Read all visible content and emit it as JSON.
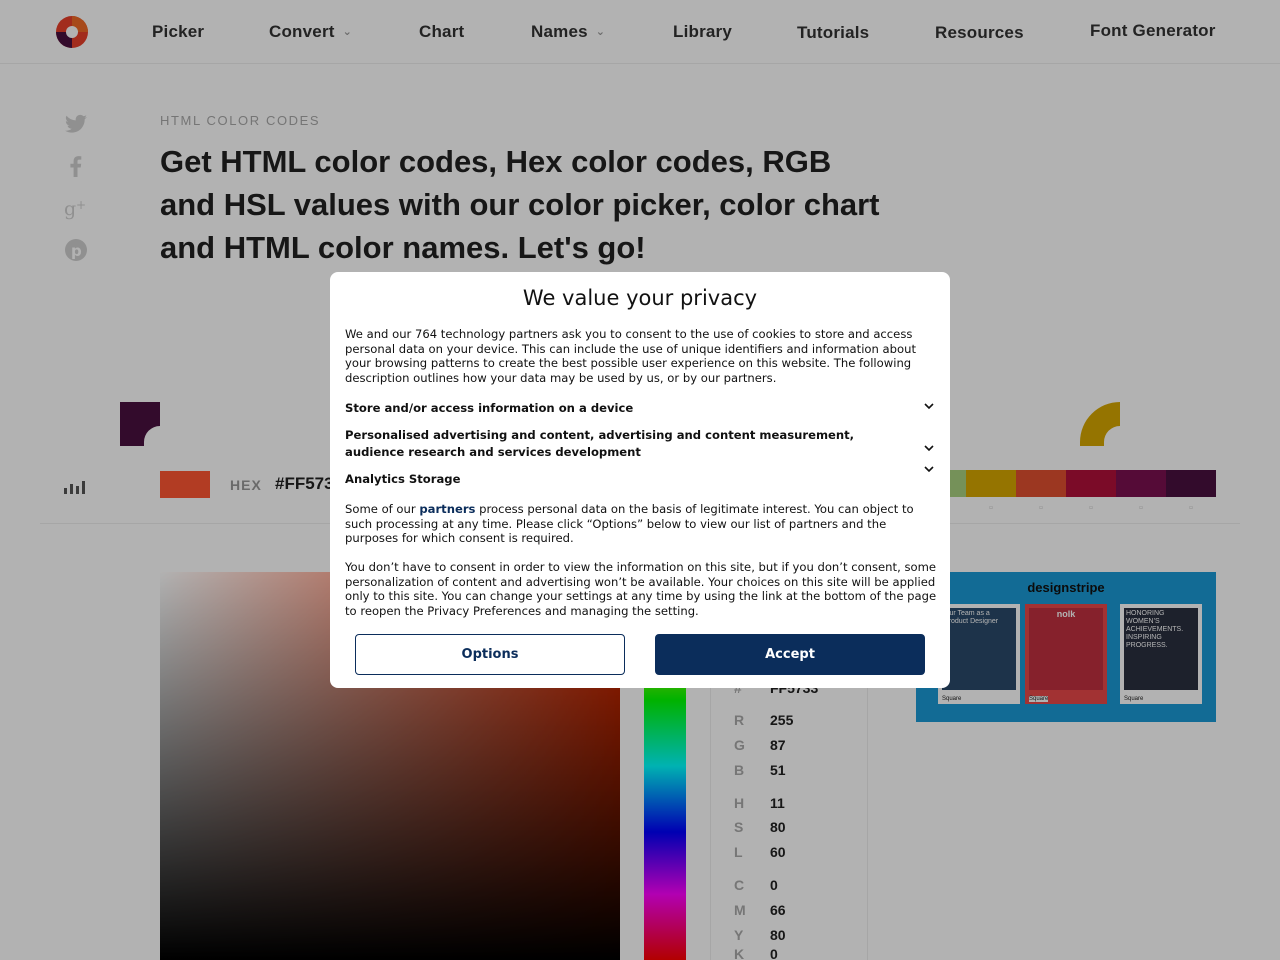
{
  "nav": {
    "items": [
      {
        "label": "Picker"
      },
      {
        "label": "Convert"
      },
      {
        "label": "Chart"
      },
      {
        "label": "Names"
      },
      {
        "label": "Library"
      },
      {
        "label": "Tutorials"
      },
      {
        "label": "Resources"
      },
      {
        "label": "Font Generator"
      }
    ]
  },
  "hero": {
    "eyebrow": "HTML COLOR CODES",
    "headline": "Get HTML color codes, Hex color codes, RGB and HSL values with our color picker, color chart and HTML color names. Let's go!"
  },
  "picker": {
    "hex_label": "HEX",
    "hex_value": "#FF573",
    "hex_field_value": "FF5733",
    "current_color": "#ff5733",
    "shades": [
      "#a8d080",
      "#d6a600",
      "#e05030",
      "#b0103a",
      "#7a1050",
      "#4a1040"
    ],
    "values": {
      "r_label": "R",
      "r": "255",
      "g_label": "G",
      "g": "87",
      "b_label": "B",
      "b": "51",
      "h_label": "H",
      "h": "11",
      "s_label": "S",
      "s": "80",
      "l_label": "L",
      "l": "60",
      "c_label": "C",
      "c": "0",
      "m_label": "M",
      "m": "66",
      "y_label": "Y",
      "y": "80",
      "k_label": "K",
      "k": "0"
    }
  },
  "ad": {
    "brand": "designstripe",
    "card1_text": "Our Team as a Product Designer",
    "card2_text": "nolk",
    "card3_text": "HONORING WOMEN'S ACHIEVEMENTS. INSPIRING PROGRESS.",
    "square": "Square"
  },
  "consent": {
    "title": "We value your privacy",
    "intro": "We and our 764 technology partners ask you to consent to the use of cookies to store and access personal data on your device. This can include the use of unique identifiers and information about your browsing patterns to create the best possible user experience on this website. The following description outlines how your data may be used by us, or by our partners.",
    "purposes": [
      "Store and/or access information on a device",
      "Personalised advertising and content, advertising and content measurement, audience research and services development",
      "Analytics Storage"
    ],
    "legit_prefix": "Some of our ",
    "legit_link": "partners",
    "legit_suffix": " process personal data on the basis of legitimate interest. You can object to such processing at any time. Please click “Options” below to view our list of partners and the purposes for which consent is required.",
    "notice": "You don’t have to consent in order to view the information on this site, but if you don’t consent, some personalization of content and advertising won’t be available. Your choices on this site will be applied only to this site. You can change your settings at any time by using the link at the bottom of the page to reopen the Privacy Preferences and managing the setting.",
    "options_label": "Options",
    "accept_label": "Accept"
  }
}
